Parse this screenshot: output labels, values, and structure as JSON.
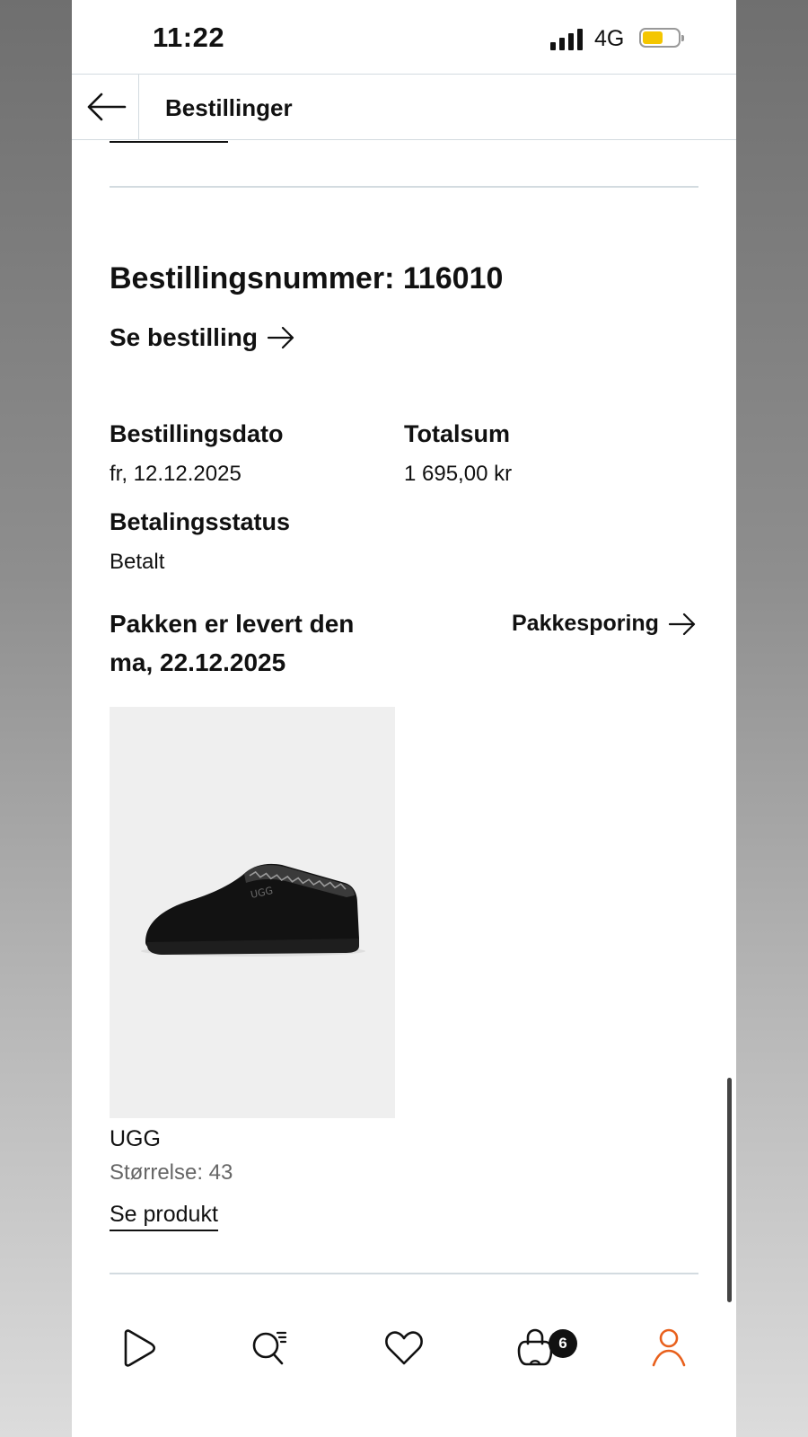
{
  "status_bar": {
    "time": "11:22",
    "network": "4G",
    "battery_color": "#F4C600"
  },
  "header": {
    "title": "Bestillinger"
  },
  "order": {
    "number_label": "Bestillingsnummer: 116010",
    "see_order_label": "Se bestilling",
    "date_label": "Bestillingsdato",
    "date_value": "fr, 12.12.2025",
    "total_label": "Totalsum",
    "total_value": "1 695,00 kr",
    "payment_label": "Betalingsstatus",
    "payment_value": "Betalt",
    "delivered_line1": "Pakken er levert den",
    "delivered_line2": "ma, 22.12.2025",
    "tracking_label": "Pakkesporing"
  },
  "product": {
    "brand": "UGG",
    "size": "Størrelse: 43",
    "see_product_label": "Se produkt",
    "image_logo_text": "UGG"
  },
  "tabbar": {
    "items": [
      {
        "icon": "play-icon"
      },
      {
        "icon": "search-list-icon"
      },
      {
        "icon": "heart-icon"
      },
      {
        "icon": "bag-icon",
        "badge": "6"
      },
      {
        "icon": "profile-icon",
        "active": true,
        "color": "#E8601C"
      }
    ]
  }
}
